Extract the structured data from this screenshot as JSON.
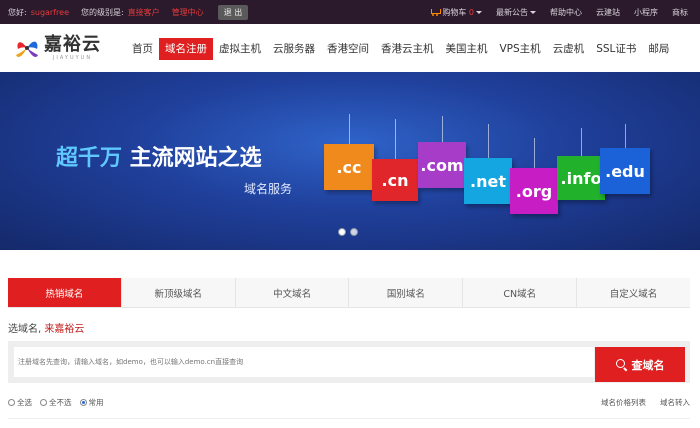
{
  "topbar": {
    "greeting": "您好:",
    "username": "sugarfree",
    "level_label": "您的级别是:",
    "level_value": "直接客户",
    "manage_center": "管理中心",
    "logout": "退 出",
    "cart_label": "购物车",
    "cart_count": "0",
    "announcements": "最新公告",
    "help": "帮助中心",
    "site_builder": "云建站",
    "mini_program": "小程序",
    "trademark": "商标"
  },
  "logo": {
    "name": "嘉裕云",
    "subtitle": "JIAYUYUN"
  },
  "nav": {
    "items": [
      {
        "label": "首页",
        "active": false
      },
      {
        "label": "域名注册",
        "active": true
      },
      {
        "label": "虚拟主机",
        "active": false
      },
      {
        "label": "云服务器",
        "active": false
      },
      {
        "label": "香港空间",
        "active": false
      },
      {
        "label": "香港云主机",
        "active": false
      },
      {
        "label": "美国主机",
        "active": false
      },
      {
        "label": "VPS主机",
        "active": false
      },
      {
        "label": "云虚机",
        "active": false
      },
      {
        "label": "SSL证书",
        "active": false
      },
      {
        "label": "邮局",
        "active": false
      }
    ]
  },
  "banner": {
    "slogan_accent": "超千万",
    "slogan_rest": " 主流网站之选",
    "subtitle": "域名服务",
    "tags": [
      {
        "text": ".cc",
        "color": "#f08a1c"
      },
      {
        "text": ".cn",
        "color": "#e0262b"
      },
      {
        "text": ".com",
        "color": "#a73cc9"
      },
      {
        "text": ".net",
        "color": "#14a6e0"
      },
      {
        "text": ".org",
        "color": "#c61ec4"
      },
      {
        "text": ".info",
        "color": "#22b12a"
      },
      {
        "text": ".edu",
        "color": "#1b62d8"
      }
    ],
    "slide_count": "2",
    "active_slide": "1"
  },
  "tabs": [
    {
      "label": "热销域名",
      "active": true
    },
    {
      "label": "新顶级域名",
      "active": false
    },
    {
      "label": "中文域名",
      "active": false
    },
    {
      "label": "国别域名",
      "active": false
    },
    {
      "label": "CN域名",
      "active": false
    },
    {
      "label": "自定义域名",
      "active": false
    }
  ],
  "search": {
    "prompt_prefix": "选域名, ",
    "prompt_brand": "来嘉裕云",
    "placeholder": "注册域名先查询，请输入域名，如demo，也可以输入demo.cn直接查询",
    "button_label": "查域名"
  },
  "options": [
    {
      "label": "全选",
      "selected": false
    },
    {
      "label": "全不选",
      "selected": false
    },
    {
      "label": "常用",
      "selected": true
    }
  ],
  "links": {
    "price_list": "域名价格列表",
    "transfer_in": "域名转入"
  },
  "colors": {
    "brand_red": "#e02020",
    "topbar_bg": "#2a1a2c",
    "banner_blue": "#1f3f9a",
    "accent_cyan": "#5ec8ff"
  }
}
